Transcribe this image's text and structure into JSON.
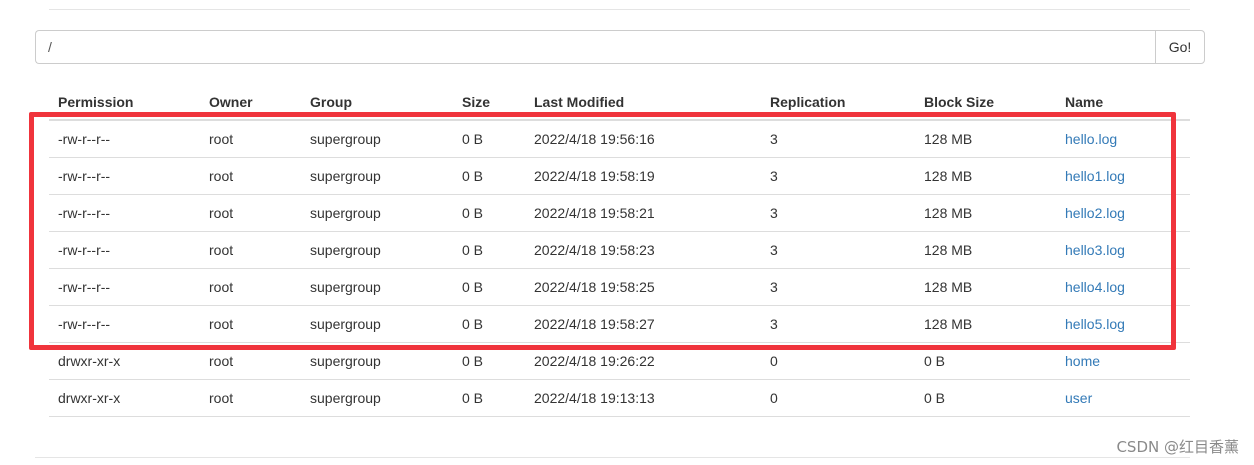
{
  "path_bar": {
    "value": "/",
    "go_label": "Go!"
  },
  "table": {
    "headers": [
      "Permission",
      "Owner",
      "Group",
      "Size",
      "Last Modified",
      "Replication",
      "Block Size",
      "Name"
    ],
    "rows": [
      {
        "permission": "-rw-r--r--",
        "owner": "root",
        "group": "supergroup",
        "size": "0 B",
        "modified": "2022/4/18 19:56:16",
        "replication": "3",
        "block_size": "128 MB",
        "name": "hello.log"
      },
      {
        "permission": "-rw-r--r--",
        "owner": "root",
        "group": "supergroup",
        "size": "0 B",
        "modified": "2022/4/18 19:58:19",
        "replication": "3",
        "block_size": "128 MB",
        "name": "hello1.log"
      },
      {
        "permission": "-rw-r--r--",
        "owner": "root",
        "group": "supergroup",
        "size": "0 B",
        "modified": "2022/4/18 19:58:21",
        "replication": "3",
        "block_size": "128 MB",
        "name": "hello2.log"
      },
      {
        "permission": "-rw-r--r--",
        "owner": "root",
        "group": "supergroup",
        "size": "0 B",
        "modified": "2022/4/18 19:58:23",
        "replication": "3",
        "block_size": "128 MB",
        "name": "hello3.log"
      },
      {
        "permission": "-rw-r--r--",
        "owner": "root",
        "group": "supergroup",
        "size": "0 B",
        "modified": "2022/4/18 19:58:25",
        "replication": "3",
        "block_size": "128 MB",
        "name": "hello4.log"
      },
      {
        "permission": "-rw-r--r--",
        "owner": "root",
        "group": "supergroup",
        "size": "0 B",
        "modified": "2022/4/18 19:58:27",
        "replication": "3",
        "block_size": "128 MB",
        "name": "hello5.log"
      },
      {
        "permission": "drwxr-xr-x",
        "owner": "root",
        "group": "supergroup",
        "size": "0 B",
        "modified": "2022/4/18 19:26:22",
        "replication": "0",
        "block_size": "0 B",
        "name": "home"
      },
      {
        "permission": "drwxr-xr-x",
        "owner": "root",
        "group": "supergroup",
        "size": "0 B",
        "modified": "2022/4/18 19:13:13",
        "replication": "0",
        "block_size": "0 B",
        "name": "user"
      }
    ]
  },
  "colors": {
    "link": "#337ab7",
    "highlight": "#f0343c",
    "border": "#dddddd"
  },
  "watermark": "CSDN @红目香薰"
}
